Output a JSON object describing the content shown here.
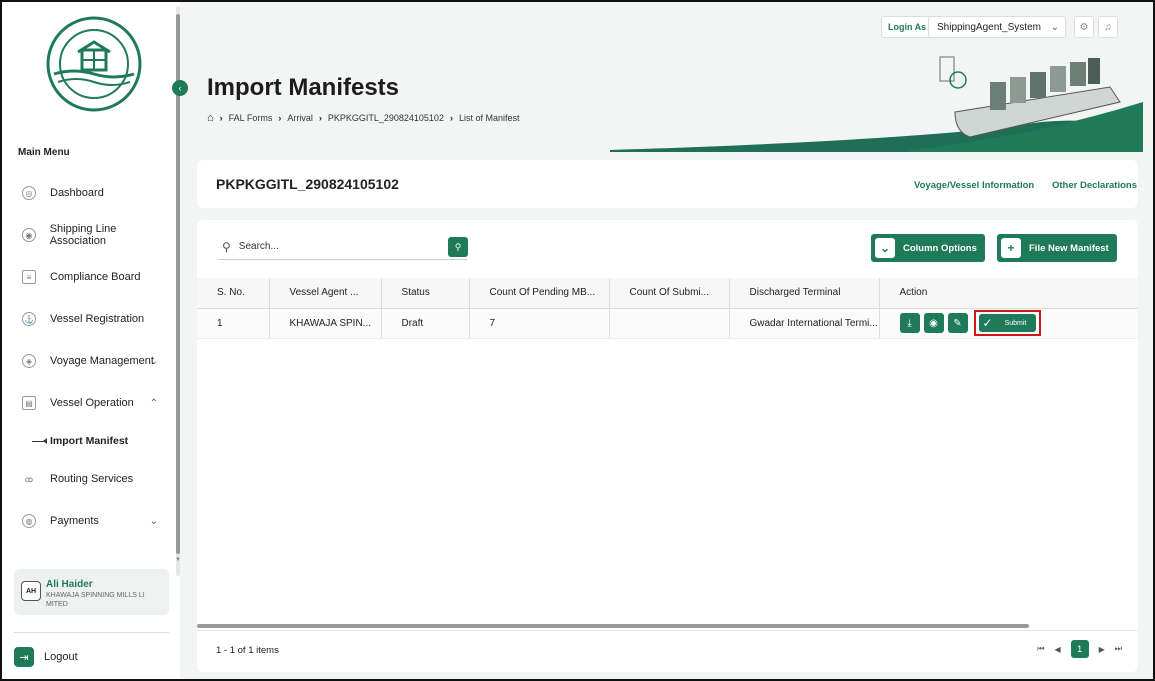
{
  "sidebar": {
    "menu_title": "Main Menu",
    "items": [
      {
        "label": "Dashboard",
        "icon": "dashboard-icon"
      },
      {
        "label": "Shipping Line Association",
        "icon": "association-icon"
      },
      {
        "label": "Compliance Board",
        "icon": "document-icon"
      },
      {
        "label": "Vessel Registration",
        "icon": "ship-icon"
      },
      {
        "label": "Voyage Management",
        "icon": "voyage-icon"
      },
      {
        "label": "Vessel Operation",
        "icon": "operation-icon"
      },
      {
        "label": "Import Manifest",
        "icon": "arrow-icon"
      },
      {
        "label": "Routing Services",
        "icon": "route-icon"
      },
      {
        "label": "Payments",
        "icon": "payments-icon"
      }
    ],
    "user": {
      "initials": "AH",
      "name": "Ali Haider",
      "org": "KHAWAJA SPINNING MILLS LI MITED"
    },
    "logout_label": "Logout"
  },
  "topbar": {
    "login_as": "Login As",
    "role": "ShippingAgent_System"
  },
  "header": {
    "title": "Import Manifests",
    "breadcrumb": [
      "FAL Forms",
      "Arrival",
      "PKPKGGITL_290824105102",
      "List of Manifest"
    ]
  },
  "voyage": {
    "id": "PKPKGGITL_290824105102",
    "link_vessel_info": "Voyage/Vessel Information",
    "link_other": "Other Declarations"
  },
  "toolbar": {
    "search_placeholder": "Search...",
    "column_options": "Column Options",
    "file_new": "File New Manifest"
  },
  "table": {
    "headers": [
      "S. No.",
      "Vessel Agent ...",
      "Status",
      "Count Of Pending MB...",
      "Count Of Submi...",
      "Discharged Terminal",
      "Action"
    ],
    "rows": [
      {
        "sno": "1",
        "agent": "KHAWAJA SPIN...",
        "status": "Draft",
        "pending": "7",
        "submitted": "",
        "terminal": "Gwadar International Termi...",
        "submit_label": "Submit"
      }
    ]
  },
  "pagination": {
    "items_text": "1 - 1 of 1 items",
    "current_page": "1"
  },
  "colors": {
    "accent": "#1f7a5a",
    "highlight": "#d01616"
  }
}
